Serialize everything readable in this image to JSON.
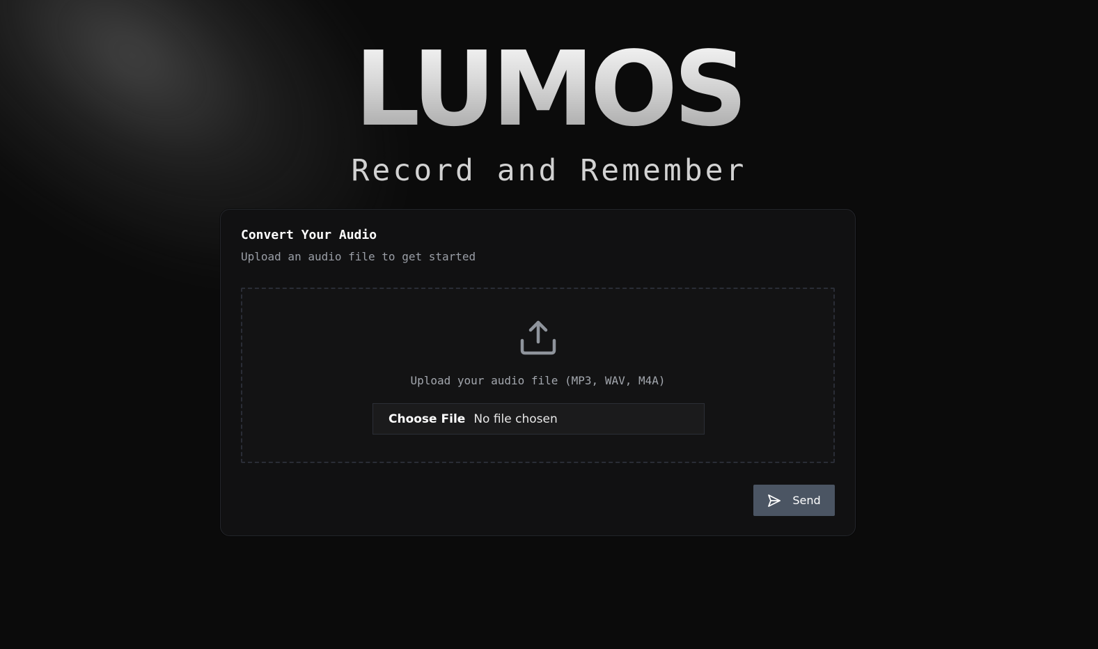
{
  "brand": {
    "logo": "LUMOS",
    "tagline": "Record and Remember"
  },
  "card": {
    "title": "Convert Your Audio",
    "subtitle": "Upload an audio file to get started"
  },
  "dropzone": {
    "icon": "upload-icon",
    "text": "Upload your audio file (MP3, WAV, M4A)"
  },
  "file_input": {
    "button_label": "Choose File",
    "status": "No file chosen"
  },
  "send_button": {
    "icon": "send-icon",
    "label": "Send"
  },
  "colors": {
    "background": "#0b0b0b",
    "card": "#111112",
    "send_button": "#4b5563",
    "muted_text": "#9a9ea6"
  }
}
